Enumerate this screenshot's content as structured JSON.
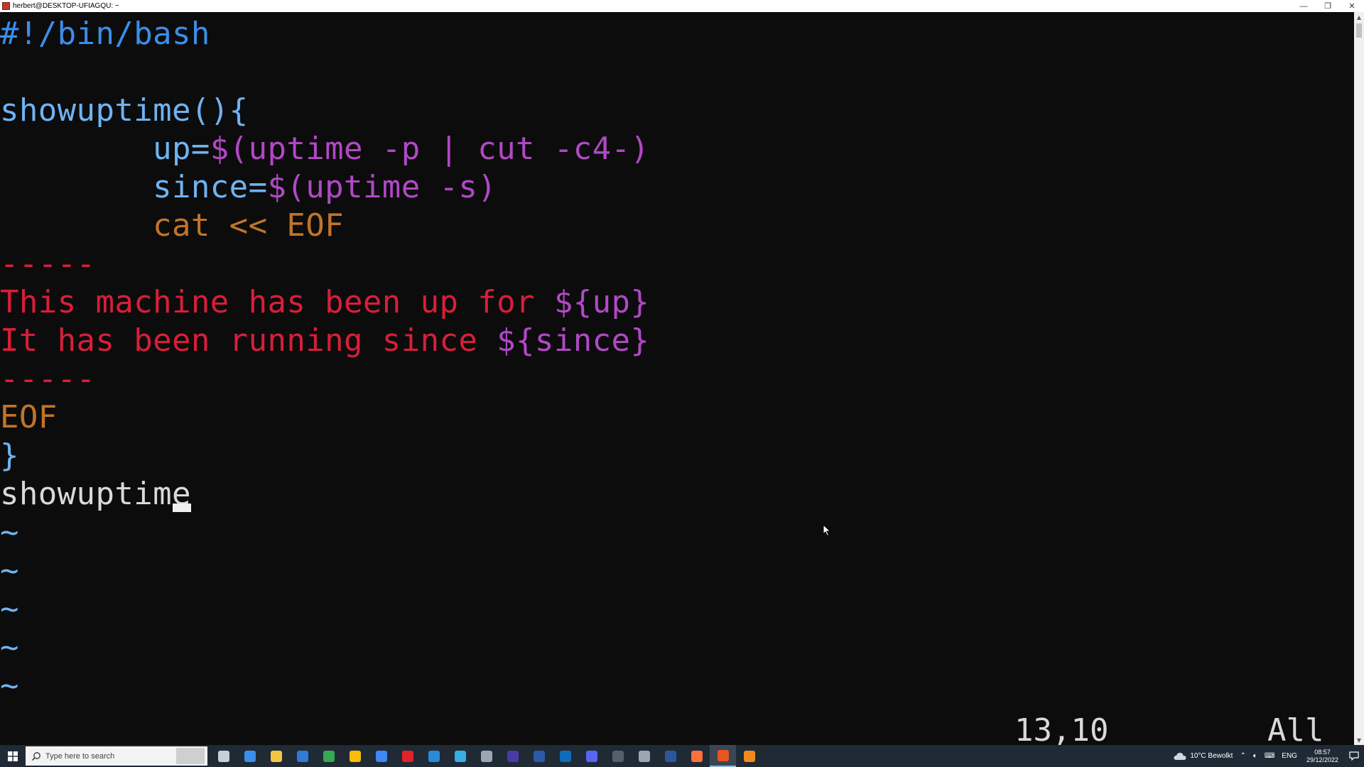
{
  "window": {
    "title": "herbert@DESKTOP-UFIAGQU: ~",
    "minimize": "—",
    "restore": "❐",
    "close": "✕"
  },
  "editor": {
    "lines": [
      {
        "parts": [
          {
            "text": "#!/bin/bash",
            "color": "blue"
          }
        ]
      },
      {
        "parts": []
      },
      {
        "parts": [
          {
            "text": "showuptime(){",
            "color": "lblue"
          }
        ]
      },
      {
        "parts": [
          {
            "text": "        up=",
            "color": "lblue"
          },
          {
            "text": "$(uptime -p | cut -c4-)",
            "color": "magenta"
          }
        ]
      },
      {
        "parts": [
          {
            "text": "        since=",
            "color": "lblue"
          },
          {
            "text": "$(uptime -s)",
            "color": "magenta"
          }
        ]
      },
      {
        "parts": [
          {
            "text": "        cat << EOF",
            "color": "orange"
          }
        ]
      },
      {
        "parts": [
          {
            "text": "-----",
            "color": "red"
          }
        ]
      },
      {
        "parts": [
          {
            "text": "This machine has been up for ",
            "color": "red"
          },
          {
            "text": "${up}",
            "color": "magenta"
          }
        ]
      },
      {
        "parts": [
          {
            "text": "It has been running since ",
            "color": "red"
          },
          {
            "text": "${since}",
            "color": "magenta"
          }
        ]
      },
      {
        "parts": [
          {
            "text": "-----",
            "color": "red"
          }
        ]
      },
      {
        "parts": [
          {
            "text": "EOF",
            "color": "orange"
          }
        ]
      },
      {
        "parts": [
          {
            "text": "}",
            "color": "lblue"
          }
        ]
      },
      {
        "parts": [
          {
            "text": "showuptime",
            "color": "white"
          }
        ]
      },
      {
        "parts": [
          {
            "text": "~",
            "color": "lblue"
          }
        ]
      },
      {
        "parts": [
          {
            "text": "~",
            "color": "lblue"
          }
        ]
      },
      {
        "parts": [
          {
            "text": "~",
            "color": "lblue"
          }
        ]
      },
      {
        "parts": [
          {
            "text": "~",
            "color": "lblue"
          }
        ]
      },
      {
        "parts": [
          {
            "text": "~",
            "color": "lblue"
          }
        ]
      }
    ],
    "cursor_line": 12,
    "status_position": "13,10",
    "status_scroll": "All"
  },
  "taskbar": {
    "search_placeholder": "Type here to search",
    "apps": [
      {
        "name": "task-view-icon",
        "color": "#c8d0d8"
      },
      {
        "name": "store-icon",
        "color": "#3b8eea"
      },
      {
        "name": "file-explorer-icon",
        "color": "#f4c542"
      },
      {
        "name": "mail-icon",
        "color": "#2f7bd6"
      },
      {
        "name": "chrome-icon",
        "color": "#34a853"
      },
      {
        "name": "chrome-icon",
        "color": "#fbbc05"
      },
      {
        "name": "chrome-icon",
        "color": "#4285f4"
      },
      {
        "name": "opera-icon",
        "color": "#e0222b"
      },
      {
        "name": "vscode-icon",
        "color": "#2a8ad6"
      },
      {
        "name": "telegram-icon",
        "color": "#37aee2"
      },
      {
        "name": "network-tool-icon",
        "color": "#9aa6b2"
      },
      {
        "name": "app-icon",
        "color": "#4a3aa8"
      },
      {
        "name": "powershell-icon",
        "color": "#2a5aa8"
      },
      {
        "name": "outlook-icon",
        "color": "#0f6cbd"
      },
      {
        "name": "discord-icon",
        "color": "#5865f2"
      },
      {
        "name": "terminal-icon",
        "color": "#555f6a"
      },
      {
        "name": "app-icon",
        "color": "#9aa6b2"
      },
      {
        "name": "word-icon",
        "color": "#2b579a"
      },
      {
        "name": "firefox-icon",
        "color": "#ff7139"
      },
      {
        "name": "ubuntu-terminal-icon",
        "color": "#e95420"
      },
      {
        "name": "vlc-icon",
        "color": "#f08a1c"
      }
    ],
    "active_app_index": 19,
    "weather": "10°C  Bewolkt",
    "language": "ENG",
    "time": "08:57",
    "date": "29/12/2022"
  },
  "colors": {
    "blue": "#3b8eea",
    "lblue": "#6fb3f2",
    "magenta": "#b148c6",
    "orange": "#c0742a",
    "red": "#d81e3a",
    "white": "#d9d9d9",
    "terminal_bg": "#0c0c0c",
    "taskbar_bg": "#1f2a35"
  }
}
